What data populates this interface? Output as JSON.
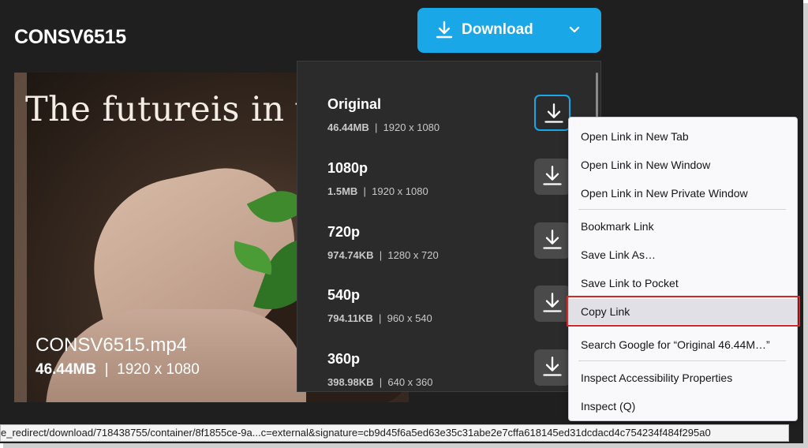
{
  "page": {
    "title": "CONSV6515"
  },
  "download_button": {
    "label": "Download",
    "icon": "download-icon",
    "dropdown_icon": "chevron-down-icon",
    "color": "#1aa7e8"
  },
  "preview": {
    "tagline": "The futureis in y",
    "filename": "CONSV6515.mp4",
    "size": "46.44MB",
    "separator": "|",
    "resolution": "1920 x 1080"
  },
  "qualities": [
    {
      "name": "Original",
      "size": "46.44MB",
      "resolution": "1920 x 1080",
      "active": true
    },
    {
      "name": "1080p",
      "size": "1.5MB",
      "resolution": "1920 x 1080",
      "active": false
    },
    {
      "name": "720p",
      "size": "974.74KB",
      "resolution": "1280 x 720",
      "active": false
    },
    {
      "name": "540p",
      "size": "794.11KB",
      "resolution": "960 x 540",
      "active": false
    },
    {
      "name": "360p",
      "size": "398.98KB",
      "resolution": "640 x 360",
      "active": false
    }
  ],
  "context_menu": {
    "items": [
      {
        "label": "Open Link in New Tab",
        "accesskey": "T"
      },
      {
        "label": "Open Link in New Window",
        "accesskey": "d"
      },
      {
        "label": "Open Link in New Private Window",
        "accesskey": "P"
      },
      {
        "label": "Bookmark Link",
        "accesskey": "B"
      },
      {
        "label": "Save Link As…",
        "accesskey": "k"
      },
      {
        "label": "Save Link to Pocket",
        "accesskey": "o"
      },
      {
        "label": "Copy Link",
        "accesskey": "L",
        "highlighted": true
      },
      {
        "label": "Search Google for “Original 46.44M…”",
        "accesskey": "S"
      },
      {
        "label": "Inspect Accessibility Properties",
        "accesskey": ""
      },
      {
        "label": "Inspect (Q)",
        "accesskey": "Q"
      }
    ]
  },
  "status_bar": {
    "url": "e_redirect/download/718438755/container/8f1855ce-9a...c=external&signature=cb9d45f6a5ed63e35c31abe2e7cffa618145ed31dcdacd4c754234f484f295a0"
  }
}
